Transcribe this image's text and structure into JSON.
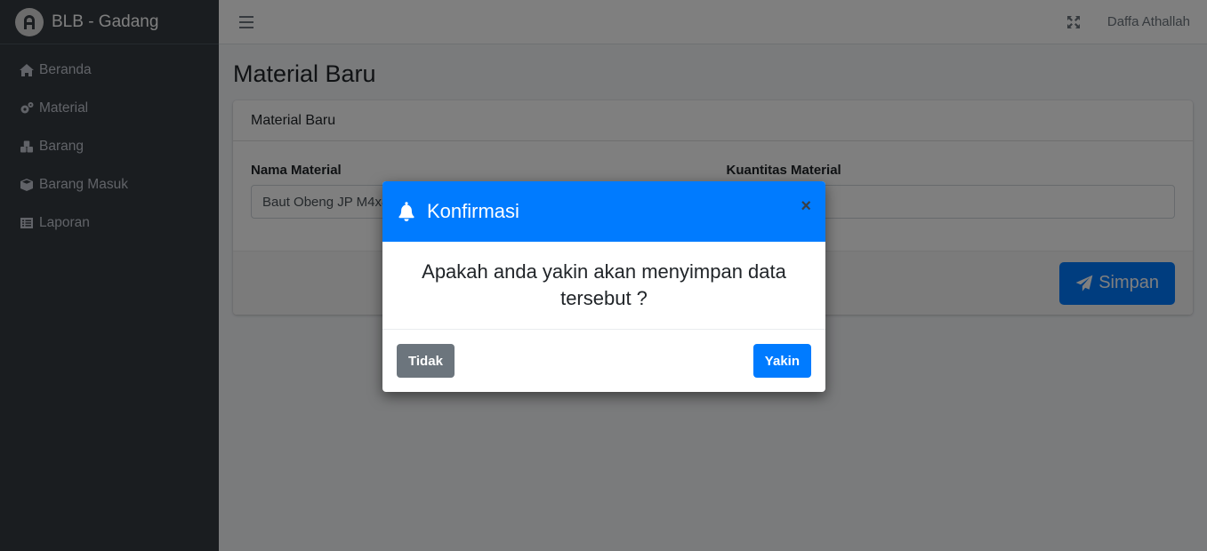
{
  "brand": {
    "name_bold": "BLB",
    "name_rest": " - Gadang"
  },
  "sidebar": {
    "items": [
      {
        "label": "Beranda",
        "icon": "home-icon"
      },
      {
        "label": "Material",
        "icon": "cogs-icon"
      },
      {
        "label": "Barang",
        "icon": "cubes-icon"
      },
      {
        "label": "Barang Masuk",
        "icon": "box-icon"
      },
      {
        "label": "Laporan",
        "icon": "list-icon"
      }
    ]
  },
  "topbar": {
    "user_name": "Daffa Athallah"
  },
  "main": {
    "page_title": "Material Baru",
    "card_title": "Material Baru",
    "fields": {
      "nama_label": "Nama Material",
      "nama_value": "Baut Obeng JP M4x8",
      "kuantitas_label": "Kuantitas Material",
      "kuantitas_value": ""
    },
    "save_label": "Simpan"
  },
  "modal": {
    "title": "Konfirmasi",
    "close": "×",
    "message": "Apakah anda yakin akan menyimpan data tersebut ?",
    "cancel_label": "Tidak",
    "confirm_label": "Yakin"
  },
  "colors": {
    "primary": "#007bff",
    "secondary": "#6c757d",
    "sidebar": "#343a40"
  }
}
